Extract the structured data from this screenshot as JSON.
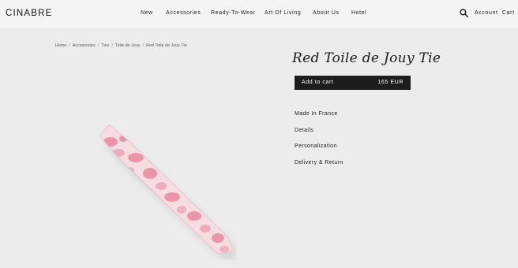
{
  "header": {
    "logo": "CINABRE",
    "nav": [
      "New",
      "Accessories",
      "Ready-To-Wear",
      "Art Of Living",
      "About Us",
      "Hotel"
    ],
    "account": "Account",
    "cart": "Cart",
    "search_icon": "search-icon"
  },
  "breadcrumb": [
    "Home",
    "Accessories",
    "Ties",
    "Toile de Jouy",
    "Red Toile de Jouy Tie"
  ],
  "product": {
    "title": "Red Toile de Jouy Tie",
    "add_to_cart_label": "Add to cart",
    "price": "165 EUR",
    "info": [
      "Made In France",
      "Details",
      "Personalization",
      "Delivery & Return"
    ]
  },
  "colors": {
    "background": "#ececec",
    "header_bg": "#f4f4f4",
    "button_bg": "#1d1d1d",
    "tie_pink": "#e98a9e",
    "tie_base": "#f6dde2"
  }
}
